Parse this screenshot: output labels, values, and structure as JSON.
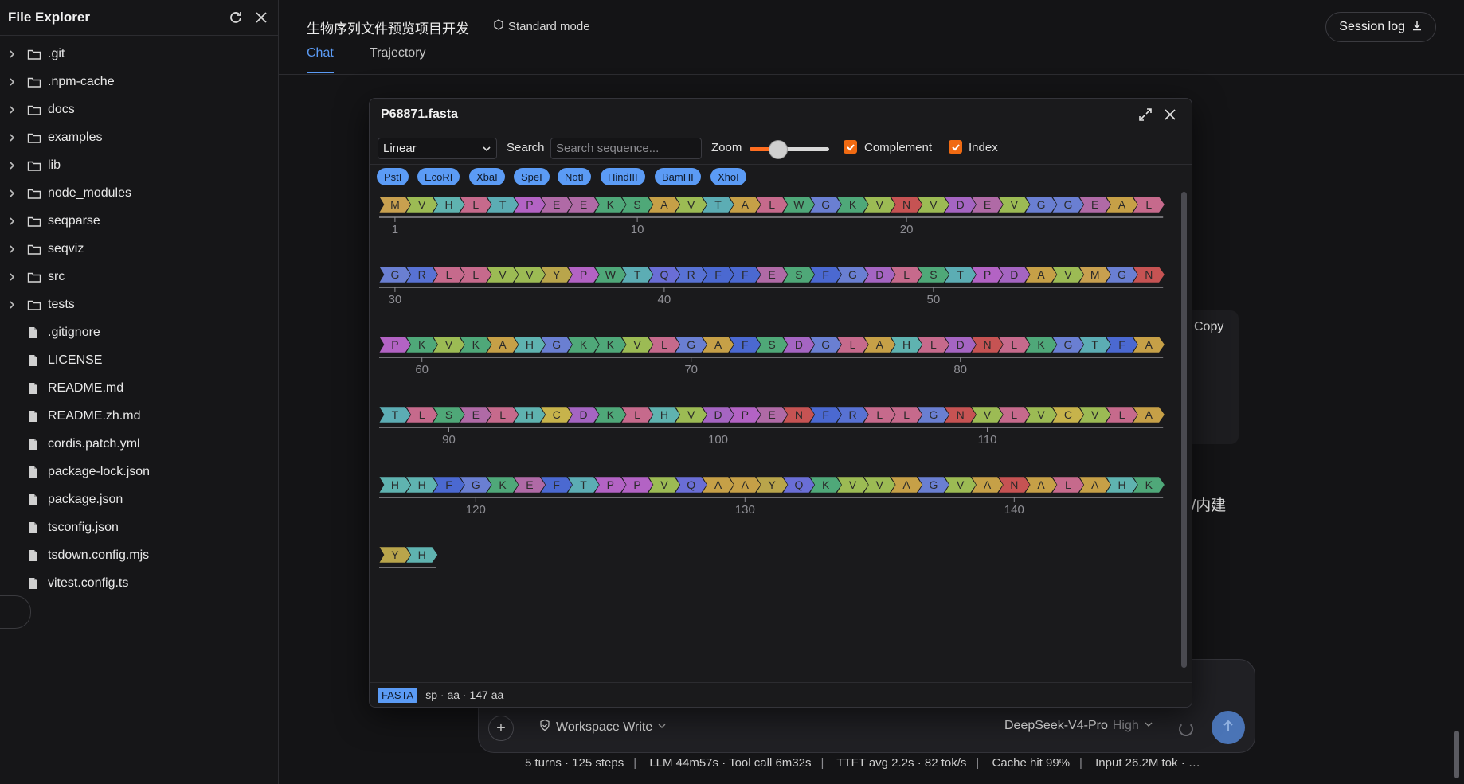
{
  "sidebar": {
    "title": "File Explorer",
    "items": [
      {
        "label": ".git",
        "type": "folder"
      },
      {
        "label": ".npm-cache",
        "type": "folder"
      },
      {
        "label": "docs",
        "type": "folder"
      },
      {
        "label": "examples",
        "type": "folder"
      },
      {
        "label": "lib",
        "type": "folder"
      },
      {
        "label": "node_modules",
        "type": "folder"
      },
      {
        "label": "seqparse",
        "type": "folder"
      },
      {
        "label": "seqviz",
        "type": "folder"
      },
      {
        "label": "src",
        "type": "folder"
      },
      {
        "label": "tests",
        "type": "folder"
      },
      {
        "label": ".gitignore",
        "type": "file"
      },
      {
        "label": "LICENSE",
        "type": "file"
      },
      {
        "label": "README.md",
        "type": "file"
      },
      {
        "label": "README.zh.md",
        "type": "file"
      },
      {
        "label": "cordis.patch.yml",
        "type": "file"
      },
      {
        "label": "package-lock.json",
        "type": "file"
      },
      {
        "label": "package.json",
        "type": "file"
      },
      {
        "label": "tsconfig.json",
        "type": "file"
      },
      {
        "label": "tsdown.config.mjs",
        "type": "file"
      },
      {
        "label": "vitest.config.ts",
        "type": "file"
      }
    ]
  },
  "header": {
    "title": "生物序列文件预览项目开发",
    "mode": "Standard mode",
    "session_log": "Session log",
    "tabs": [
      "Chat",
      "Trajectory"
    ]
  },
  "background": {
    "copy": "Copy",
    "fragment": "/内建"
  },
  "viewer": {
    "filename": "P68871.fasta",
    "view_mode": "Linear",
    "search_label": "Search",
    "search_placeholder": "Search sequence...",
    "zoom_label": "Zoom",
    "zoom_level": 0.35,
    "complement_label": "Complement",
    "complement_checked": true,
    "index_label": "Index",
    "index_checked": true,
    "enzymes": [
      "PstI",
      "EcoRI",
      "XbaI",
      "SpeI",
      "NotI",
      "HindIII",
      "BamHI",
      "XhoI"
    ],
    "sequence": "MVHLTPEEKSAVTALWGKVNVDEVGGEALGRLLVVYPWTQRFFESFGDLSTPDAVMGNPKVKAHGKKVLGAFSDGLAHLDNLKGTFATLSELHCDKLHVDPENFRLLGNVLVCVLAHHFGKEFTPPVQAAYQKVVAGVANALAHKYH",
    "footer_format": "FASTA",
    "footer_info": "sp · aa · 147 aa"
  },
  "composer": {
    "workspace": "Workspace Write",
    "model": "DeepSeek-V4-Pro",
    "level": "High"
  },
  "stats": [
    "5 turns · 125 steps",
    "LLM 44m57s · Tool call 6m32s",
    "TTFT avg 2.2s · 82 tok/s",
    "Cache hit 99%",
    "Input 26.2M tok · …"
  ],
  "colors": {
    "accent": "#5b9bf5",
    "checkbox": "#f06a12",
    "aa": {
      "M": "#c8a04f",
      "V": "#9cbb54",
      "H": "#5fb3b0",
      "L": "#c66a8c",
      "T": "#5cadb4",
      "P": "#b363c4",
      "E": "#b06aa6",
      "K": "#4fa879",
      "S": "#4fa878",
      "A": "#c6a047",
      "W": "#4fa879",
      "G": "#6a7fd2",
      "N": "#c65353",
      "D": "#a565c2",
      "R": "#5872d4",
      "Y": "#b9a54b",
      "Q": "#6a6ed6",
      "F": "#4b69d1",
      "C": "#c7b34b"
    }
  }
}
